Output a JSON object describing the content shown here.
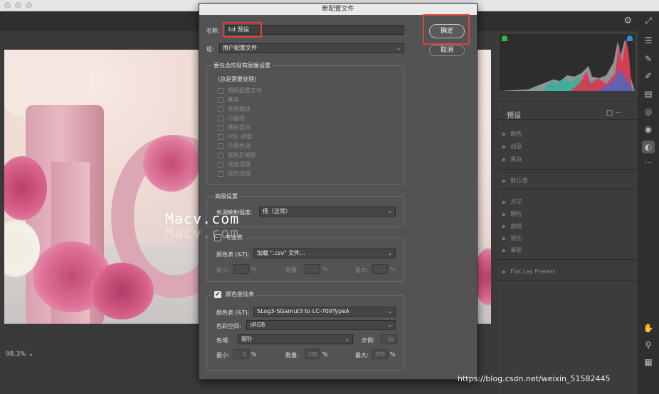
{
  "dialog": {
    "title": "新配置文件",
    "name_label": "名称:",
    "name_value": "lut 预设",
    "group_label": "组:",
    "group_value": "用户配置文件",
    "ok_label": "确定",
    "cancel_label": "取消",
    "include_title": "要包含的现有图像设置",
    "always_process": "(总是需要处理)",
    "include_items": [
      "相机配置文件",
      "基本",
      "参数曲线",
      "点曲线",
      "黑白混合",
      "HSL 调整",
      "分离色调",
      "裁剪后晕影",
      "渐变滤镜",
      "径向滤镜"
    ],
    "advanced_title": "高级设置",
    "tone_map_label": "色调映射强度:",
    "tone_map_value": "低（正常）",
    "section1_title": "专业表",
    "section1_table_label": "颜色表 (&T):",
    "section1_table_value": "加载 \".csv\" 文件...",
    "section1_min_label": "最小:",
    "section1_min_unit": "%",
    "section1_count_label": "数量:",
    "section1_count_unit": "%",
    "section1_max_label": "最大:",
    "section1_max_unit": "%",
    "lut_title": "颜色查找表",
    "lut_table_label": "颜色表 (&T):",
    "lut_table_value": "SLog3-SGamut3 to LC-709TypeA",
    "lut_space_label": "色彩空间:",
    "lut_space_value": "sRGB",
    "lut_gamut_label": "色域:",
    "lut_gamut_value": "剔针",
    "lut_sample_label": "示例:",
    "lut_sample_value": "32",
    "lut_min_label": "最小:",
    "lut_min_value": "0",
    "lut_min_unit": "%",
    "lut_count_label": "数量:",
    "lut_count_value": "100",
    "lut_count_unit": "%",
    "lut_max_label": "最大:",
    "lut_max_value": "200",
    "lut_max_unit": "%"
  },
  "right_panel": {
    "presets_title": "预设",
    "presets_icons": "□ ···",
    "items": [
      "颜色",
      "创意",
      "黑白",
      "默认值",
      "光学",
      "颗粒",
      "曲线",
      "锐化",
      "晕影",
      "Flat Lay Presets"
    ]
  },
  "canvas": {
    "zoom": "98.3% ⌄",
    "watermark_main": "Macv.com",
    "watermark_shadow": "Macv.com"
  },
  "credit": "https://blog.csdn.net/weixin_51582445",
  "icons": [
    "gear-icon",
    "expand-icon",
    "sliders-icon",
    "brush-icon",
    "pen-icon",
    "gradient-icon",
    "radial-icon",
    "eye-icon",
    "mask-icon",
    "more-icon",
    "hand-icon",
    "eyedropper-icon",
    "grid-icon"
  ]
}
